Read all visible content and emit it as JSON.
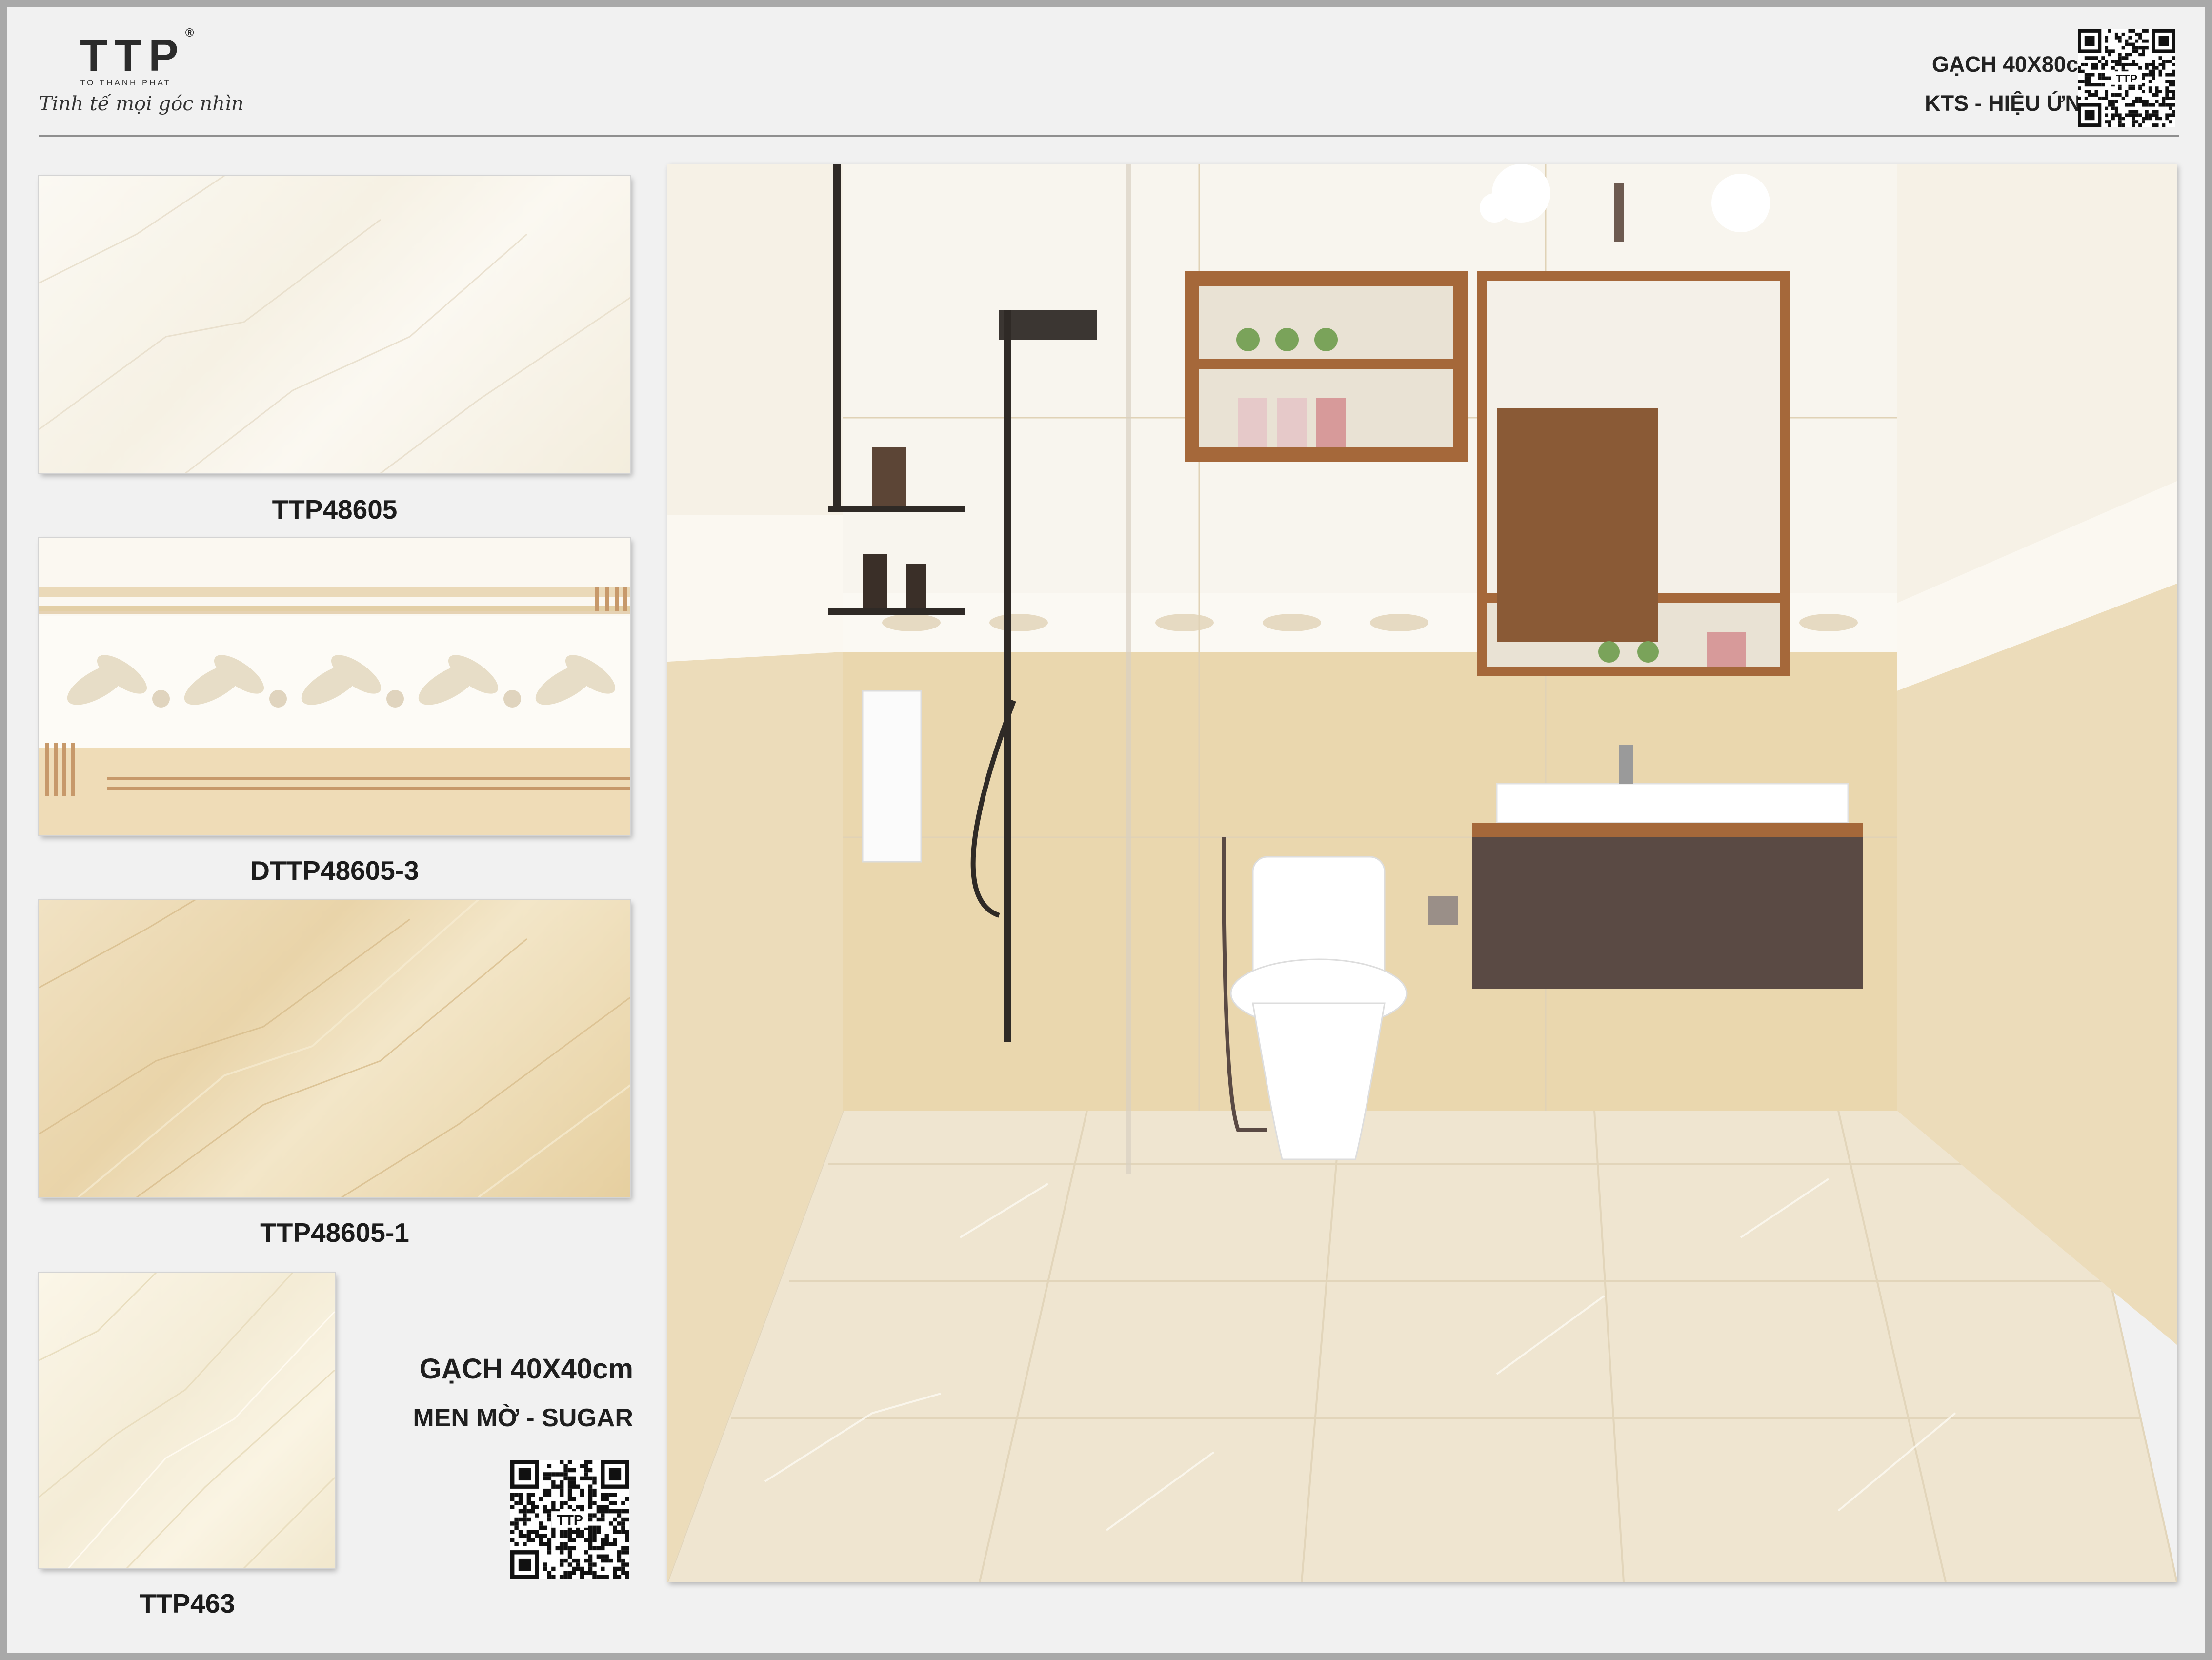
{
  "brand": {
    "logo": "TTP",
    "registered": "®",
    "sub": "TO THANH PHAT",
    "tagline": "Tinh tế mọi góc nhìn"
  },
  "header": {
    "title": "GẠCH 40X80cm",
    "subtitle": "KTS - HIỆU ỨNG",
    "qr_icon": "qr-code-icon"
  },
  "tiles": [
    {
      "code": "TTP48605",
      "tone": "#f7f2e6"
    },
    {
      "code": "DTTP48605-3",
      "tone": "#fbf8f1"
    },
    {
      "code": "TTP48605-1",
      "tone": "#ecd9b1"
    },
    {
      "code": "TTP463",
      "tone": "#f6eed9"
    }
  ],
  "floor_tile": {
    "title": "GẠCH 40X40cm",
    "subtitle": "MEN MỜ - SUGAR",
    "qr_icon": "qr-code-icon"
  },
  "qr_label": "TTP",
  "scene": {
    "description_icon": "bathroom-render-image",
    "wall_top_color": "#f8f5ee",
    "wall_bottom_color": "#ead7ae",
    "floor_color": "#efe5d0",
    "wood_color": "#a5683a",
    "cabinet_color": "#5a4a44"
  }
}
